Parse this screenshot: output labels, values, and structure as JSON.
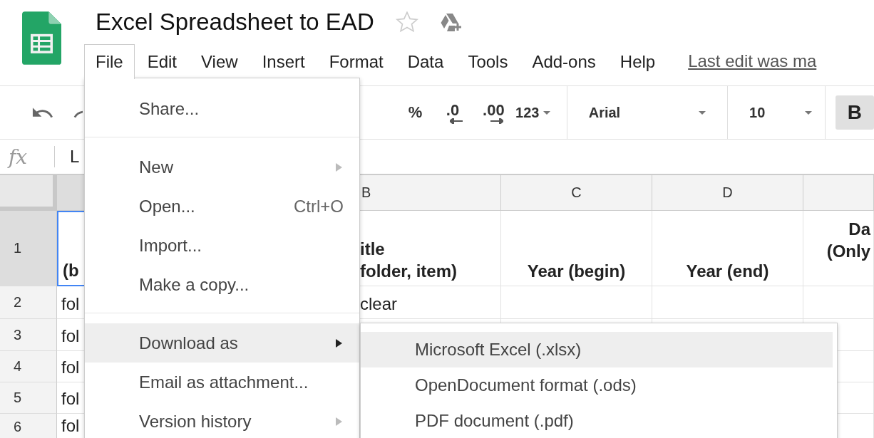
{
  "document": {
    "title": "Excel Spreadsheet to EAD",
    "starred": false
  },
  "menu_bar": [
    {
      "label": "File",
      "selected": true
    },
    {
      "label": "Edit",
      "selected": false
    },
    {
      "label": "View",
      "selected": false
    },
    {
      "label": "Insert",
      "selected": false
    },
    {
      "label": "Format",
      "selected": false
    },
    {
      "label": "Data",
      "selected": false
    },
    {
      "label": "Tools",
      "selected": false
    },
    {
      "label": "Add-ons",
      "selected": false
    },
    {
      "label": "Help",
      "selected": false
    }
  ],
  "last_edit": "Last edit was ma",
  "toolbar": {
    "percent": "%",
    "decrease_decimals": ".0",
    "increase_decimals": ".00",
    "number_format": "123",
    "font": "Arial",
    "font_size": "10",
    "bold": {
      "label": "B",
      "on": true
    }
  },
  "formula_bar": {
    "fx": "fx",
    "value": "L"
  },
  "sheet": {
    "columns": [
      {
        "selected": true
      },
      {
        "label": "B",
        "selected": false
      },
      {
        "label": "C",
        "selected": false
      },
      {
        "label": "D",
        "selected": false
      },
      {
        "selected": false
      }
    ],
    "rows": [
      {
        "number": "1",
        "selected": true,
        "bold": true,
        "cells": [
          "(b",
          "itle\n folder, item)",
          "Year (begin)",
          "Year (end)",
          "Da\n(Only"
        ]
      },
      {
        "number": "2",
        "selected": false,
        "bold": false,
        "cells": [
          "fol",
          "clear",
          null,
          null,
          null
        ]
      },
      {
        "number": "3",
        "selected": false,
        "bold": false,
        "cells": [
          "fol",
          null,
          null,
          null,
          null
        ]
      },
      {
        "number": "4",
        "selected": false,
        "bold": false,
        "cells": [
          "fol",
          null,
          null,
          null,
          null
        ]
      },
      {
        "number": "5",
        "selected": false,
        "bold": false,
        "cells": [
          "fol",
          null,
          null,
          null,
          null
        ]
      },
      {
        "number": "6",
        "selected": false,
        "bold": false,
        "cells": [
          "fol",
          null,
          null,
          null,
          null
        ]
      }
    ]
  },
  "file_menu": [
    {
      "kind": "item",
      "label": "Share...",
      "selected": false
    },
    {
      "kind": "divider"
    },
    {
      "kind": "item",
      "label": "New",
      "submenu": true,
      "selected": false
    },
    {
      "kind": "item",
      "label": "Open...",
      "shortcut": "Ctrl+O",
      "selected": false
    },
    {
      "kind": "item",
      "label": "Import...",
      "selected": false
    },
    {
      "kind": "item",
      "label": "Make a copy...",
      "selected": false
    },
    {
      "kind": "divider"
    },
    {
      "kind": "item",
      "label": "Download as",
      "submenu": true,
      "selected": true
    },
    {
      "kind": "item",
      "label": "Email as attachment...",
      "selected": false
    },
    {
      "kind": "item",
      "label": "Version history",
      "submenu": true,
      "selected": false
    }
  ],
  "download_submenu": [
    {
      "label": "Microsoft Excel (.xlsx)",
      "selected": true
    },
    {
      "label": "OpenDocument format (.ods)",
      "selected": false
    },
    {
      "label": "PDF document (.pdf)",
      "selected": false
    }
  ]
}
